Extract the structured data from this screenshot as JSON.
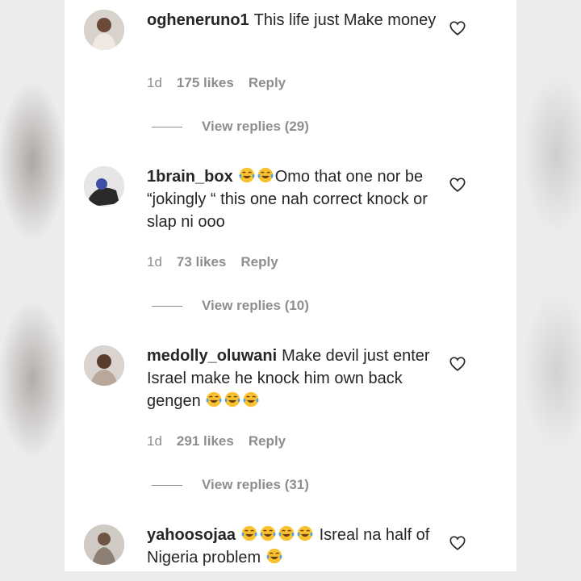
{
  "comments": [
    {
      "username": "ogheneruno1",
      "text_parts": [
        "This life just Make money"
      ],
      "emojis_before": 0,
      "emojis_after": 0,
      "time": "1d",
      "likes": "175 likes",
      "reply": "Reply",
      "view_replies": "View replies (29)"
    },
    {
      "username": "1brain_box",
      "text_parts": [
        "Omo that one nor be “jokingly “ this one nah correct knock or slap ni ooo"
      ],
      "emojis_before": 2,
      "emojis_after": 0,
      "time": "1d",
      "likes": "73 likes",
      "reply": "Reply",
      "view_replies": "View replies (10)"
    },
    {
      "username": "medolly_oluwani",
      "text_parts": [
        "Make devil just enter Israel make he knock him own back gengen"
      ],
      "emojis_before": 0,
      "emojis_after": 3,
      "time": "1d",
      "likes": "291 likes",
      "reply": "Reply",
      "view_replies": "View replies (31)"
    },
    {
      "username": "yahoosojaa",
      "text_parts": [
        "Isreal na half of Nigeria problem"
      ],
      "emojis_before": 4,
      "emojis_after": 1
    }
  ],
  "icons": {
    "like": "heart-outline-icon",
    "emoji": "face-with-tears-of-joy-emoji"
  },
  "colors": {
    "text": "#262626",
    "secondary": "#8e8e8e",
    "emoji_face": "#f9c22e"
  }
}
